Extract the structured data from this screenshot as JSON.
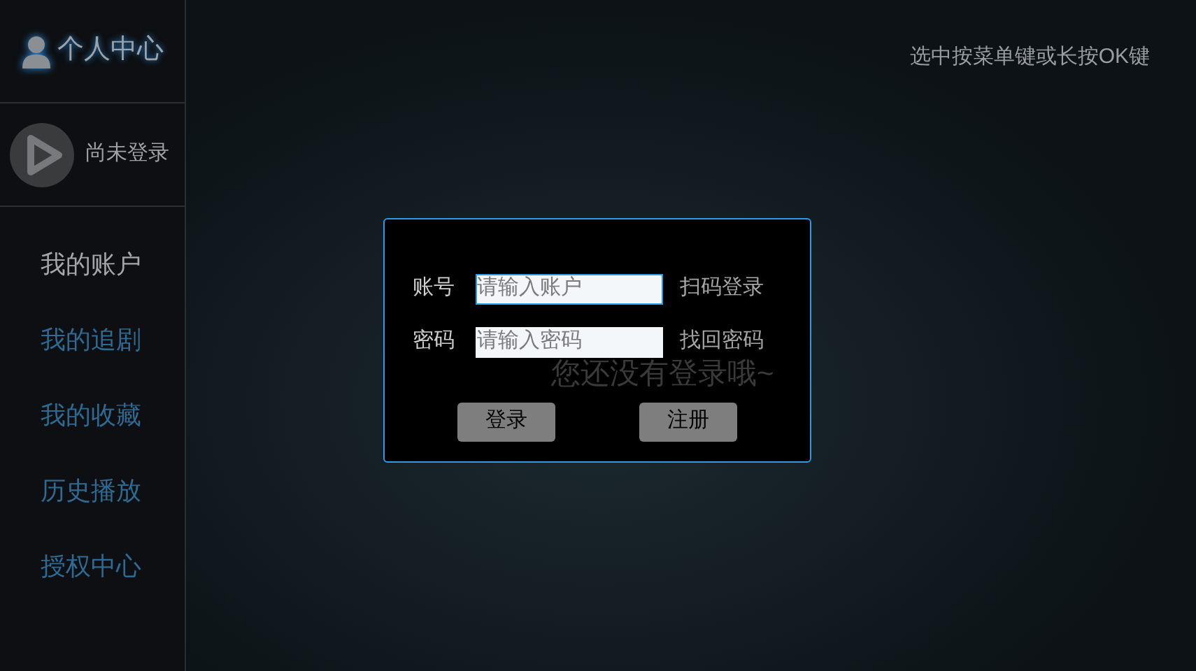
{
  "sidebar": {
    "title": "个人中心",
    "user_status": "尚未登录",
    "items": [
      {
        "label": "我的账户",
        "selected": true
      },
      {
        "label": "我的追剧",
        "selected": false
      },
      {
        "label": "我的收藏",
        "selected": false
      },
      {
        "label": "历史播放",
        "selected": false
      },
      {
        "label": "授权中心",
        "selected": false
      }
    ]
  },
  "hint": "选中按菜单键或长按OK键",
  "empty_message": "您还没有登录哦~",
  "login_dialog": {
    "fields": [
      {
        "label": "账号",
        "placeholder": "请输入账户",
        "focused": true,
        "link": "扫码登录"
      },
      {
        "label": "密码",
        "placeholder": "请输入密码",
        "focused": false,
        "link": "找回密码"
      }
    ],
    "buttons": [
      "登录",
      "注册"
    ]
  }
}
